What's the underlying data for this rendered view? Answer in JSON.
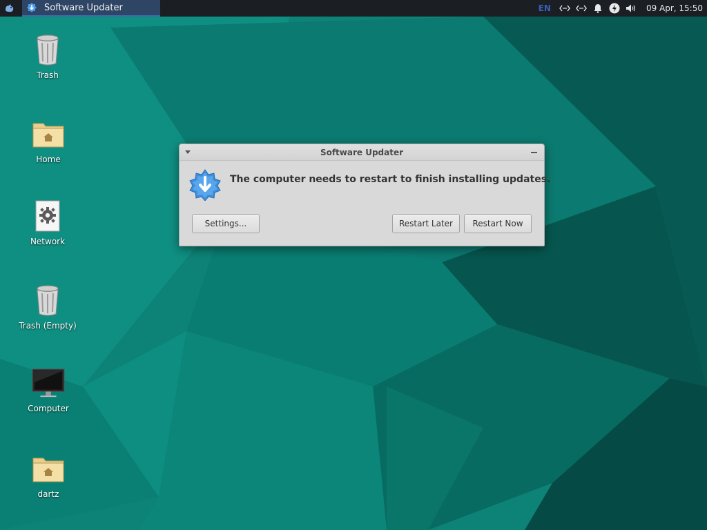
{
  "panel": {
    "task_title": "Software Updater",
    "keyboard_layout": "EN",
    "clock": "09 Apr, 15:50",
    "icons": [
      "whisker-menu-icon",
      "software-updater-icon",
      "network-icon",
      "network-icon-2",
      "notification-bell-icon",
      "power-icon",
      "volume-icon"
    ]
  },
  "desktop": {
    "icons": [
      {
        "label": "Trash",
        "icon": "trash-icon"
      },
      {
        "label": "Home",
        "icon": "home-folder-icon"
      },
      {
        "label": "Network",
        "icon": "network-gear-icon"
      },
      {
        "label": "Trash (Empty)",
        "icon": "trash-icon"
      },
      {
        "label": "Computer",
        "icon": "monitor-icon"
      },
      {
        "label": "dartz",
        "icon": "home-folder-icon"
      }
    ]
  },
  "dialog": {
    "title": "Software Updater",
    "message": "The computer needs to restart to finish installing updates.",
    "settings_label": "Settings...",
    "restart_later_label": "Restart Later",
    "restart_now_label": "Restart Now"
  },
  "colors": {
    "wallpaper_base": "#0c7f74",
    "wallpaper_dark": "#064e48",
    "panel_bg": "#1b1f24",
    "task_active_bg": "#2e4565",
    "dialog_bg": "#d9d9d9",
    "update_icon_blue": "#3d8fdc"
  }
}
